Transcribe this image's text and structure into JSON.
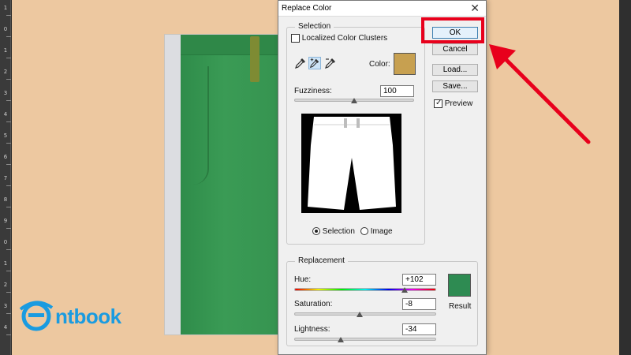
{
  "ruler": {
    "ticks": [
      "1",
      "0",
      "1",
      "2",
      "3",
      "4",
      "5",
      "6",
      "7",
      "8",
      "9",
      "0",
      "1",
      "2",
      "3",
      "4"
    ]
  },
  "dialog": {
    "title": "Replace Color",
    "close_glyph": "✕",
    "selection": {
      "legend": "Selection",
      "localized_label": "Localized Color Clusters",
      "localized_checked": false,
      "color_label": "Color:",
      "color_value": "#c7a050",
      "fuzziness_label": "Fuzziness:",
      "fuzziness_value": "100",
      "fuzziness_level": 0.5,
      "view_selection_label": "Selection",
      "view_image_label": "Image",
      "view_selected": "Selection"
    },
    "buttons": {
      "ok": "OK",
      "cancel": "Cancel",
      "load": "Load...",
      "save": "Save..."
    },
    "preview": {
      "label": "Preview",
      "checked": true
    },
    "replacement": {
      "legend": "Replacement",
      "hue_label": "Hue:",
      "hue_value": "+102",
      "hue_level": 0.78,
      "saturation_label": "Saturation:",
      "saturation_value": "-8",
      "saturation_level": 0.46,
      "lightness_label": "Lightness:",
      "lightness_value": "-34",
      "lightness_level": 0.33,
      "result_label": "Result",
      "result_color": "#2e8b52"
    }
  },
  "watermark": {
    "text": "ntbook"
  },
  "colors": {
    "canvas": "#edc8a0",
    "highlight": "#e8001c",
    "shorts": "#3a9b55"
  }
}
